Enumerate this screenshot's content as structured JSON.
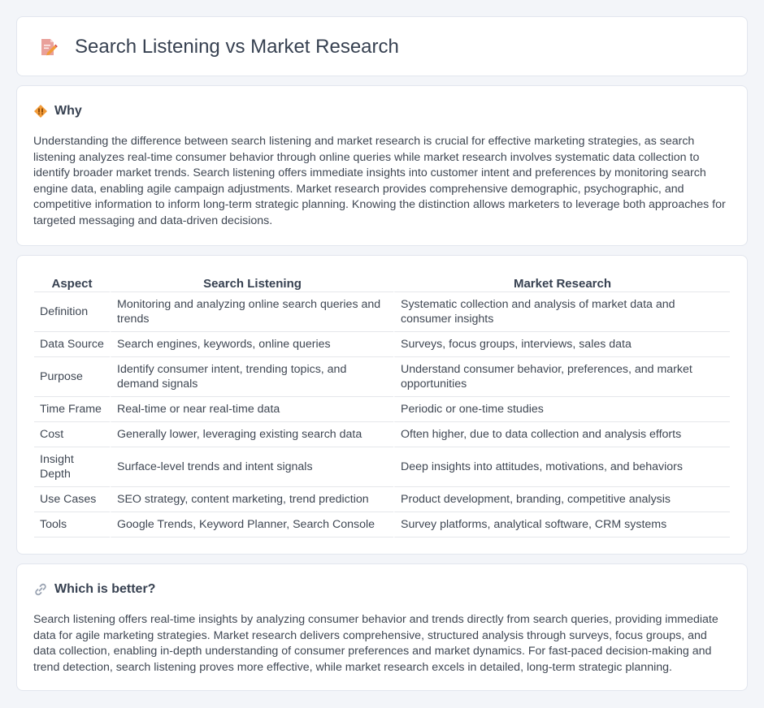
{
  "header": {
    "title": "Search Listening vs Market Research",
    "icon": "document-pencil-icon"
  },
  "why": {
    "icon": "diamond-warning-icon",
    "title": "Why",
    "body": "Understanding the difference between search listening and market research is crucial for effective marketing strategies, as search listening analyzes real-time consumer behavior through online queries while market research involves systematic data collection to identify broader market trends. Search listening offers immediate insights into customer intent and preferences by monitoring search engine data, enabling agile campaign adjustments. Market research provides comprehensive demographic, psychographic, and competitive information to inform long-term strategic planning. Knowing the distinction allows marketers to leverage both approaches for targeted messaging and data-driven decisions."
  },
  "table": {
    "headers": [
      "Aspect",
      "Search Listening",
      "Market Research"
    ],
    "rows": [
      [
        "Definition",
        "Monitoring and analyzing online search queries and trends",
        "Systematic collection and analysis of market data and consumer insights"
      ],
      [
        "Data Source",
        "Search engines, keywords, online queries",
        "Surveys, focus groups, interviews, sales data"
      ],
      [
        "Purpose",
        "Identify consumer intent, trending topics, and demand signals",
        "Understand consumer behavior, preferences, and market opportunities"
      ],
      [
        "Time Frame",
        "Real-time or near real-time data",
        "Periodic or one-time studies"
      ],
      [
        "Cost",
        "Generally lower, leveraging existing search data",
        "Often higher, due to data collection and analysis efforts"
      ],
      [
        "Insight Depth",
        "Surface-level trends and intent signals",
        "Deep insights into attitudes, motivations, and behaviors"
      ],
      [
        "Use Cases",
        "SEO strategy, content marketing, trend prediction",
        "Product development, branding, competitive analysis"
      ],
      [
        "Tools",
        "Google Trends, Keyword Planner, Search Console",
        "Survey platforms, analytical software, CRM systems"
      ]
    ]
  },
  "better": {
    "icon": "link-icon",
    "title": "Which is better?",
    "body": "Search listening offers real-time insights by analyzing consumer behavior and trends directly from search queries, providing immediate data for agile marketing strategies. Market research delivers comprehensive, structured analysis through surveys, focus groups, and data collection, enabling in-depth understanding of consumer preferences and market dynamics. For fast-paced decision-making and trend detection, search listening proves more effective, while market research excels in detailed, long-term strategic planning."
  },
  "colors": {
    "background": "#f3f5f9",
    "card": "#ffffff",
    "border": "#e2e6ee",
    "text": "#374151",
    "accent": "#f29b38"
  }
}
